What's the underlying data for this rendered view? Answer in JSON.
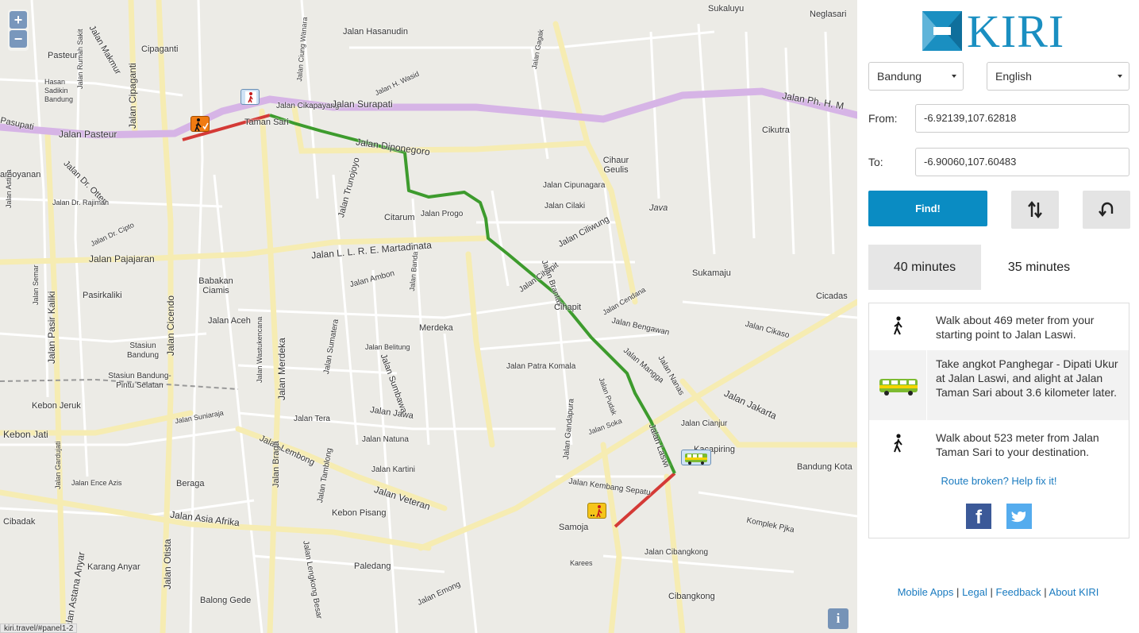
{
  "map": {
    "zoom_in": "+",
    "zoom_out": "−",
    "info": "i",
    "status_url": "kiri.travel/#panel1-2",
    "labels": [
      "Pasteur",
      "Cipaganti",
      "Hasan Sadikin Bandung",
      "Jalan Rumah Sakit",
      "Jalan Pasteur",
      "Pasupati",
      "Jalan Cipaganti",
      "Jalan Makmur",
      "Jalan Dr. Otten",
      "Jalan Dr. Rajiman",
      "Jalan Dr. Cipto",
      "amoyanan",
      "Jalan Astina",
      "Jalan Pajajaran",
      "Pasirkaliki",
      "Jalan Pasir Kaliki",
      "Jalan Semar",
      "Jalan Cicendo",
      "Babakan Ciamis",
      "Jalan Aceh",
      "Stasiun Bandung",
      "Stasiun Bandung-Pintu Selatan",
      "Kebon Jeruk",
      "Kebon Jati",
      "Jalan Suniaraja",
      "Beraga",
      "Jalan Ence Azis",
      "Jalan Gardujati",
      "Jalan Otista",
      "Jalan Asia Afrika",
      "Cibadak",
      "Jalan Astana Anyar",
      "Karang Anyar",
      "Balong Gede",
      "Taman Sari",
      "Jalan Cikapayang",
      "Jalan Surapati",
      "Jalan Ph. H. M",
      "Jalan Hasanudin",
      "Jalan Ciung Wanara",
      "Jalan H. Wasid",
      "Jalan Gagak",
      "Jalan Diponegoro",
      "Jalan Trunojoyo",
      "Citarum",
      "Jalan Progo",
      "Jalan Cipunagara",
      "Jalan Ciliwung",
      "Jalan Cilaki",
      "Cihaur Geulis",
      "Java",
      "Jalan L. L. R. E. Martadinata",
      "Jalan Ambon",
      "Jalan Banda",
      "Merdeka",
      "Jalan Merdeka",
      "Jalan Wastukencana",
      "Jalan Sumatera",
      "Jalan Belitung",
      "Jalan Sumbawa",
      "Jalan Patra Komala",
      "Jalan Cihapit",
      "Jalan Brantas",
      "Cihapit",
      "Jalan Cendana",
      "Jalan Bengawan",
      "Jalan Mangga",
      "Jalan Nanas",
      "Jalan Jakarta",
      "Jalan Laswi",
      "Kacapiring",
      "Jalan Cianjur",
      "Jalan Kembang Sepatu",
      "Samoja",
      "Jalan Pudak",
      "Jalan Soka",
      "Jalan Gandapura",
      "Jalan Jawa",
      "Jalan Natuna",
      "Jalan Tera",
      "Jalan Lembong",
      "Jalan Braga",
      "Jalan Tamblong",
      "Jalan Kartini",
      "Kebon Pisang",
      "Jalan Veteran",
      "Paledang",
      "Jalan Emong",
      "Jalan Cibangkong",
      "Cibangkong",
      "Komplek Pjka",
      "Karees",
      "Sukaluyu",
      "Neglasari",
      "Cikutra",
      "Sukamaju",
      "Cicadas",
      "Jalan Cikaso",
      "Bandung Kota",
      "Jalan Tera",
      "Jalan Lengkong Besar"
    ]
  },
  "panel": {
    "logo_text": "KIRI",
    "city_select": "Bandung",
    "language_select": "English",
    "from_label": "From:",
    "from_value": "-6.92139,107.62818",
    "to_label": "To:",
    "to_value": "-6.90060,107.60483",
    "find_button": "Find!",
    "swap_icon": "swap-icon",
    "reset_icon": "reset-icon",
    "tabs": [
      "40 minutes",
      "35 minutes"
    ],
    "steps": [
      {
        "icon": "walk-icon",
        "text": "Walk about 469 meter from your starting point to Jalan Laswi."
      },
      {
        "icon": "angkot-icon",
        "text": "Take angkot Panghegar - Dipati Ukur at Jalan Laswi, and alight at Jalan Taman Sari about 3.6 kilometer later."
      },
      {
        "icon": "walk-icon",
        "text": "Walk about 523 meter from Jalan Taman Sari to your destination."
      }
    ],
    "fix_link": "Route broken? Help fix it!",
    "facebook_icon": "f",
    "footer": {
      "mobile_apps": "Mobile Apps",
      "legal": "Legal",
      "feedback": "Feedback",
      "about": "About KIRI",
      "sep": "|"
    }
  },
  "colors": {
    "accent": "#0a8cc3",
    "route_walk": "#d43a36",
    "route_angkot": "#3d9b2d",
    "main_road": "#d6b4e6",
    "secondary_road": "#f6ecb2"
  }
}
